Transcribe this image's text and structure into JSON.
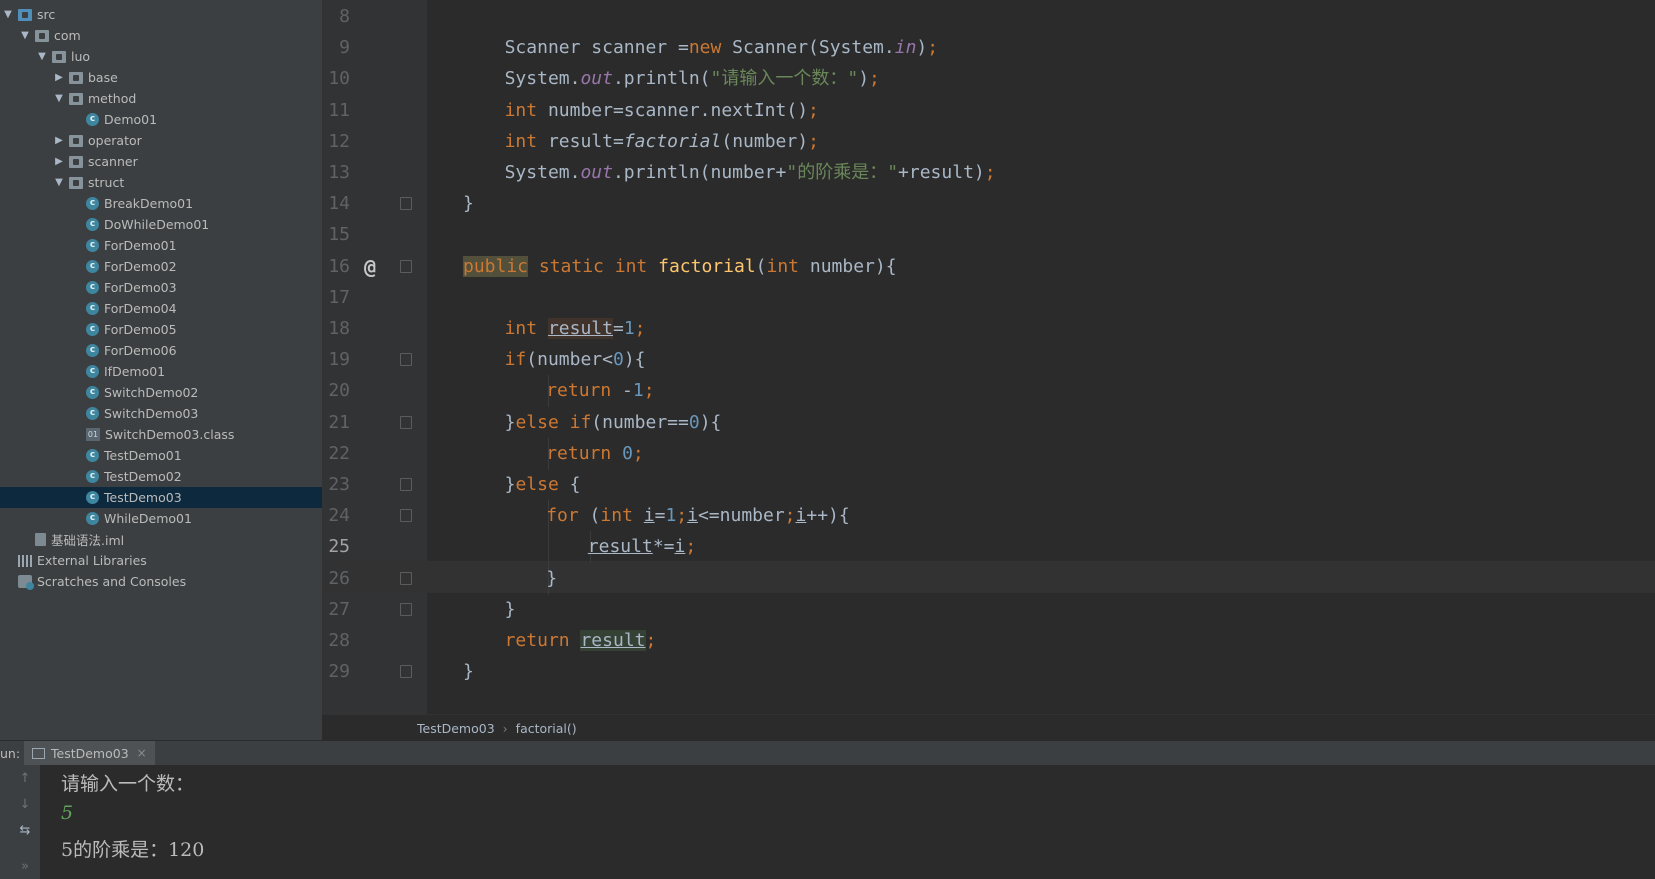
{
  "project_tree": [
    {
      "label": "src",
      "type": "src-folder",
      "arrow": "down",
      "indent": 0
    },
    {
      "label": "com",
      "type": "folder",
      "arrow": "down",
      "indent": 1
    },
    {
      "label": "luo",
      "type": "folder",
      "arrow": "down",
      "indent": 2
    },
    {
      "label": "base",
      "type": "folder",
      "arrow": "right",
      "indent": 3
    },
    {
      "label": "method",
      "type": "folder",
      "arrow": "down",
      "indent": 3
    },
    {
      "label": "Demo01",
      "type": "class",
      "arrow": "none",
      "indent": 4
    },
    {
      "label": "operator",
      "type": "folder",
      "arrow": "right",
      "indent": 3
    },
    {
      "label": "scanner",
      "type": "folder",
      "arrow": "right",
      "indent": 3
    },
    {
      "label": "struct",
      "type": "folder",
      "arrow": "down",
      "indent": 3
    },
    {
      "label": "BreakDemo01",
      "type": "class",
      "arrow": "none",
      "indent": 4
    },
    {
      "label": "DoWhileDemo01",
      "type": "class",
      "arrow": "none",
      "indent": 4
    },
    {
      "label": "ForDemo01",
      "type": "class",
      "arrow": "none",
      "indent": 4
    },
    {
      "label": "ForDemo02",
      "type": "class",
      "arrow": "none",
      "indent": 4
    },
    {
      "label": "ForDemo03",
      "type": "class",
      "arrow": "none",
      "indent": 4
    },
    {
      "label": "ForDemo04",
      "type": "class",
      "arrow": "none",
      "indent": 4
    },
    {
      "label": "ForDemo05",
      "type": "class",
      "arrow": "none",
      "indent": 4
    },
    {
      "label": "ForDemo06",
      "type": "class",
      "arrow": "none",
      "indent": 4
    },
    {
      "label": "IfDemo01",
      "type": "class",
      "arrow": "none",
      "indent": 4
    },
    {
      "label": "SwitchDemo02",
      "type": "class",
      "arrow": "none",
      "indent": 4
    },
    {
      "label": "SwitchDemo03",
      "type": "class",
      "arrow": "none",
      "indent": 4
    },
    {
      "label": "SwitchDemo03.class",
      "type": "classfile",
      "arrow": "none",
      "indent": 4
    },
    {
      "label": "TestDemo01",
      "type": "class",
      "arrow": "none",
      "indent": 4
    },
    {
      "label": "TestDemo02",
      "type": "class",
      "arrow": "none",
      "indent": 4
    },
    {
      "label": "TestDemo03",
      "type": "class",
      "arrow": "none",
      "indent": 4,
      "selected": true
    },
    {
      "label": "WhileDemo01",
      "type": "class",
      "arrow": "none",
      "indent": 4
    },
    {
      "label": "基础语法.iml",
      "type": "iml",
      "arrow": "none",
      "indent": 1
    },
    {
      "label": "External Libraries",
      "type": "library",
      "arrow": "none",
      "indent": 0
    },
    {
      "label": "Scratches and Consoles",
      "type": "scratch",
      "arrow": "none",
      "indent": 0
    }
  ],
  "editor": {
    "current_line": "25",
    "lines": [
      {
        "num": "8",
        "indent": 0,
        "tokens": []
      },
      {
        "num": "9",
        "indent": 2,
        "tokens": [
          [
            "Scanner scanner =",
            ""
          ],
          [
            "new",
            "kw"
          ],
          [
            " Scanner(System.",
            ""
          ],
          [
            "in",
            "fld"
          ],
          [
            ")",
            ""
          ],
          [
            ";",
            "kw"
          ]
        ]
      },
      {
        "num": "10",
        "indent": 2,
        "tokens": [
          [
            "System.",
            ""
          ],
          [
            "out",
            "fld"
          ],
          [
            ".println(",
            ""
          ],
          [
            "\"请输入一个数：\"",
            "str"
          ],
          [
            ")",
            ""
          ],
          [
            ";",
            "kw"
          ]
        ]
      },
      {
        "num": "11",
        "indent": 2,
        "tokens": [
          [
            "int",
            "kw"
          ],
          [
            " number=scanner.nextInt()",
            ""
          ],
          [
            ";",
            "kw"
          ]
        ]
      },
      {
        "num": "12",
        "indent": 2,
        "tokens": [
          [
            "int",
            "kw"
          ],
          [
            " result=",
            ""
          ],
          [
            "factorial",
            "ital"
          ],
          [
            "(number)",
            ""
          ],
          [
            ";",
            "kw"
          ]
        ]
      },
      {
        "num": "13",
        "indent": 2,
        "tokens": [
          [
            "System.",
            ""
          ],
          [
            "out",
            "fld"
          ],
          [
            ".println(number+",
            ""
          ],
          [
            "\"的阶乘是：\"",
            "str"
          ],
          [
            "+result)",
            ""
          ],
          [
            ";",
            "kw"
          ]
        ]
      },
      {
        "num": "14",
        "indent": 1,
        "tokens": [
          [
            "}",
            ""
          ]
        ],
        "fold": true
      },
      {
        "num": "15",
        "indent": 0,
        "tokens": []
      },
      {
        "num": "16",
        "indent": 1,
        "tokens": [
          [
            "public",
            "kw hl-pub"
          ],
          [
            " ",
            ""
          ],
          [
            "static",
            "kw"
          ],
          [
            " ",
            ""
          ],
          [
            "int",
            "kw"
          ],
          [
            " ",
            ""
          ],
          [
            "factorial",
            "fn"
          ],
          [
            "(",
            ""
          ],
          [
            "int",
            "kw"
          ],
          [
            " number){",
            ""
          ]
        ],
        "fold": true,
        "at": true
      },
      {
        "num": "17",
        "indent": 0,
        "tokens": []
      },
      {
        "num": "18",
        "indent": 2,
        "tokens": [
          [
            "int",
            "kw"
          ],
          [
            " ",
            ""
          ],
          [
            "result",
            "ul hl-res"
          ],
          [
            "=",
            ""
          ],
          [
            "1",
            "num"
          ],
          [
            ";",
            "kw"
          ]
        ]
      },
      {
        "num": "19",
        "indent": 2,
        "tokens": [
          [
            "if",
            "kw"
          ],
          [
            "(number<",
            ""
          ],
          [
            "0",
            "num"
          ],
          [
            "){",
            ""
          ]
        ],
        "fold": true
      },
      {
        "num": "20",
        "indent": 3,
        "tokens": [
          [
            "return",
            "kw"
          ],
          [
            " -",
            ""
          ],
          [
            "1",
            "num"
          ],
          [
            ";",
            "kw"
          ]
        ]
      },
      {
        "num": "21",
        "indent": 2,
        "tokens": [
          [
            "}",
            ""
          ],
          [
            "else if",
            "kw"
          ],
          [
            "(number==",
            ""
          ],
          [
            "0",
            "num"
          ],
          [
            "){",
            ""
          ]
        ],
        "fold": true
      },
      {
        "num": "22",
        "indent": 3,
        "tokens": [
          [
            "return",
            "kw"
          ],
          [
            " ",
            ""
          ],
          [
            "0",
            "num"
          ],
          [
            ";",
            "kw"
          ]
        ]
      },
      {
        "num": "23",
        "indent": 2,
        "tokens": [
          [
            "}",
            ""
          ],
          [
            "else",
            "kw"
          ],
          [
            " {",
            ""
          ]
        ],
        "fold": true
      },
      {
        "num": "24",
        "indent": 3,
        "tokens": [
          [
            "for",
            "kw"
          ],
          [
            " (",
            ""
          ],
          [
            "int",
            "kw"
          ],
          [
            " ",
            ""
          ],
          [
            "i",
            "ul"
          ],
          [
            "=",
            ""
          ],
          [
            "1",
            "num"
          ],
          [
            ";",
            "kw"
          ],
          [
            "i",
            "ul"
          ],
          [
            "<=number",
            ""
          ],
          [
            ";",
            "kw"
          ],
          [
            "i",
            "ul"
          ],
          [
            "++){",
            ""
          ]
        ],
        "fold": true
      },
      {
        "num": "25",
        "indent": 4,
        "tokens": [
          [
            "result",
            "ul"
          ],
          [
            "*=",
            ""
          ],
          [
            "i",
            "ul"
          ],
          [
            ";",
            "kw"
          ]
        ]
      },
      {
        "num": "26",
        "indent": 3,
        "tokens": [
          [
            "}",
            ""
          ]
        ],
        "fold": true
      },
      {
        "num": "27",
        "indent": 2,
        "tokens": [
          [
            "}",
            ""
          ]
        ],
        "fold": true
      },
      {
        "num": "28",
        "indent": 2,
        "tokens": [
          [
            "return",
            "kw"
          ],
          [
            " ",
            ""
          ],
          [
            "result",
            "ul hl-ret"
          ],
          [
            ";",
            "kw"
          ]
        ]
      },
      {
        "num": "29",
        "indent": 1,
        "tokens": [
          [
            "}",
            ""
          ]
        ],
        "fold": true
      }
    ]
  },
  "breadcrumb": {
    "file": "TestDemo03",
    "method": "factorial()",
    "separator": "›"
  },
  "run_panel": {
    "label": "un:",
    "tab": "TestDemo03",
    "close_glyph": "×",
    "console": {
      "prompt": "请输入一个数：",
      "input": "5",
      "result": "5的阶乘是：120"
    }
  },
  "icons": {
    "up_arrow": "↑",
    "down_arrow": "↓",
    "wrap": "⇆",
    "more": "»"
  }
}
